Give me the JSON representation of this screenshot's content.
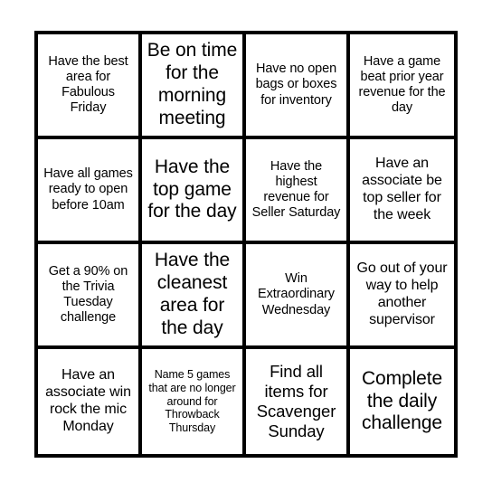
{
  "card": {
    "type": "bingo-card",
    "columns": 4,
    "rows": 4,
    "border_color": "#000000",
    "cell_background": "#ffffff",
    "page_background": "#ffffff",
    "cells": [
      {
        "text": "Have the best area for Fabulous Friday",
        "size": "sm"
      },
      {
        "text": "Be on time for the morning meeting",
        "size": "xl"
      },
      {
        "text": "Have no open bags or boxes for inventory",
        "size": "sm"
      },
      {
        "text": "Have a game beat prior year revenue for the day",
        "size": "sm"
      },
      {
        "text": "Have all games ready to open before 10am",
        "size": "sm"
      },
      {
        "text": "Have the top game for the day",
        "size": "xl"
      },
      {
        "text": "Have the highest revenue for Seller Saturday",
        "size": "sm"
      },
      {
        "text": "Have an associate be top seller for the week",
        "size": "md"
      },
      {
        "text": "Get a 90% on the Trivia Tuesday challenge",
        "size": "sm"
      },
      {
        "text": "Have the cleanest area for the day",
        "size": "xl"
      },
      {
        "text": "Win Extraordinary Wednesday",
        "size": "sm"
      },
      {
        "text": "Go out of your way to help another supervisor",
        "size": "md"
      },
      {
        "text": "Have an associate win rock the mic Monday",
        "size": "md"
      },
      {
        "text": "Name 5 games that are no longer around for Throwback Thursday",
        "size": "xs"
      },
      {
        "text": "Find all items for Scavenger Sunday",
        "size": "lg"
      },
      {
        "text": "Complete the daily challenge",
        "size": "xl"
      }
    ]
  }
}
